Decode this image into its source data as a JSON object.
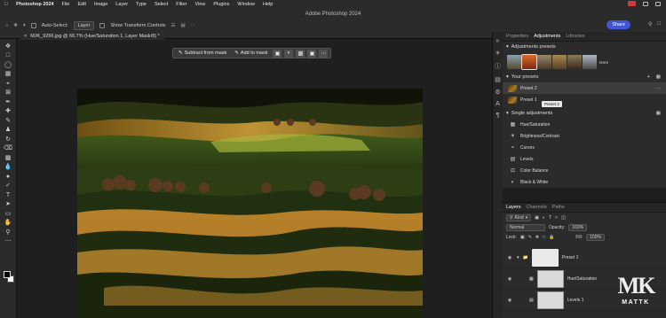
{
  "menubar": {
    "app_name": "Photoshop 2024",
    "items": [
      "File",
      "Edit",
      "Image",
      "Layer",
      "Type",
      "Select",
      "Filter",
      "View",
      "Plugins",
      "Window",
      "Help"
    ]
  },
  "window_title": "Adobe Photoshop 2024",
  "options_bar": {
    "auto_select_label": "Auto-Select:",
    "auto_select_value": "Layer",
    "transform_label": "Show Transform Controls",
    "share_label": "Share"
  },
  "document_tab": {
    "title": "MJK_9266.jpg @ 66.7% (Hue/Saturation 1, Layer Mask/8) *"
  },
  "contextual_task_bar": {
    "subtract_label": "Subtract from mask",
    "add_label": "Add to mask"
  },
  "adjustments_panel": {
    "tabs": [
      "Properties",
      "Adjustments",
      "Libraries"
    ],
    "active_tab": "Adjustments",
    "presets_header": "Adjustments presets",
    "more_label": "More",
    "your_presets_header": "Your presets",
    "presets": [
      "Preset 2",
      "Preset 1"
    ],
    "tooltip": "Preset 2",
    "single_header": "Single adjustments",
    "adjustments": [
      "Hue/Saturation",
      "Brightness/Contrast",
      "Curves",
      "Levels",
      "Color Balance",
      "Black & White"
    ]
  },
  "layers_panel": {
    "tabs": [
      "Layers",
      "Channels",
      "Paths"
    ],
    "active_tab": "Layers",
    "filter_label": "Kind",
    "blend_mode": "Normal",
    "opacity_label": "Opacity:",
    "opacity_value": "100%",
    "lock_label": "Lock:",
    "fill_label": "Fill:",
    "fill_value": "100%",
    "layers": [
      "Preset 1",
      "Hue/Saturation",
      "Levels 1"
    ]
  },
  "watermark": {
    "mark": "MK",
    "text": "MATTK"
  },
  "colors": {
    "accent": "#3f56d9",
    "panel_bg": "#2b2b2b",
    "canvas_bg": "#1f1f1f"
  }
}
